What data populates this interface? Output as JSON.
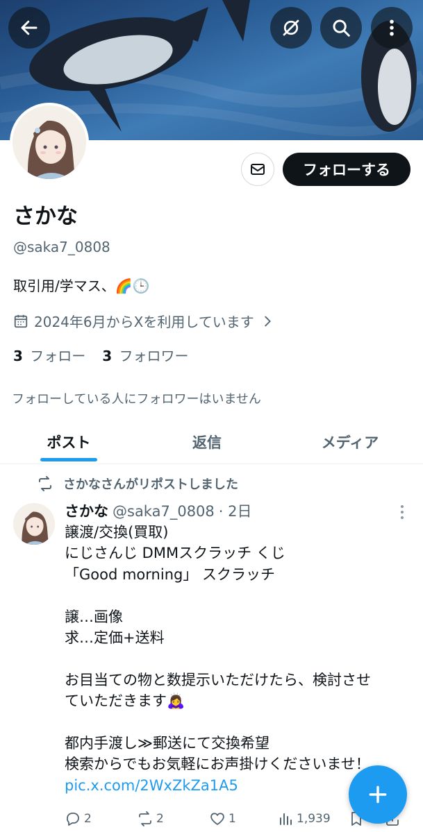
{
  "profile": {
    "name": "さかな",
    "handle": "@saka7_0808",
    "bio": "取引用/学マス、🌈🕒",
    "joined": "2024年6月からXを利用しています",
    "following_count": "3",
    "following_label": "フォロー",
    "followers_count": "3",
    "followers_label": "フォロワー",
    "mutual_note": "フォローしている人にフォロワーはいません",
    "follow_button": "フォローする"
  },
  "tabs": [
    {
      "label": "ポスト",
      "active": true
    },
    {
      "label": "返信",
      "active": false
    },
    {
      "label": "メディア",
      "active": false
    }
  ],
  "post": {
    "repost_text": "さかなさんがリポストしました",
    "author_name": "さかな",
    "author_handle": "@saka7_0808",
    "time": "· 2日",
    "lines": [
      "譲渡/交換(買取)",
      "にじさんじ DMMスクラッチ くじ",
      "「Good morning」 スクラッチ",
      "",
      "譲…画像",
      "求…定価+送料",
      "",
      "お目当ての物と数提示いただけたら、検討させ",
      "ていただきます🙇‍♀️",
      "",
      "都内手渡し≫郵送にて交換希望",
      "検索からでもお気軽にお声掛けくださいませ！"
    ],
    "link": "pic.x.com/2WxZkZa1A5",
    "replies": "2",
    "reposts": "2",
    "likes": "1",
    "views": "1,939"
  },
  "colors": {
    "accent": "#1d9bf0",
    "text": "#0f1419",
    "secondary": "#536471"
  },
  "icons": [
    "back-arrow-icon",
    "no-notification-icon",
    "search-icon",
    "more-vertical-icon",
    "mail-icon",
    "calendar-icon",
    "chevron-right-icon",
    "repost-icon",
    "reply-icon",
    "like-icon",
    "views-icon",
    "bookmark-icon",
    "share-icon",
    "plus-icon"
  ]
}
